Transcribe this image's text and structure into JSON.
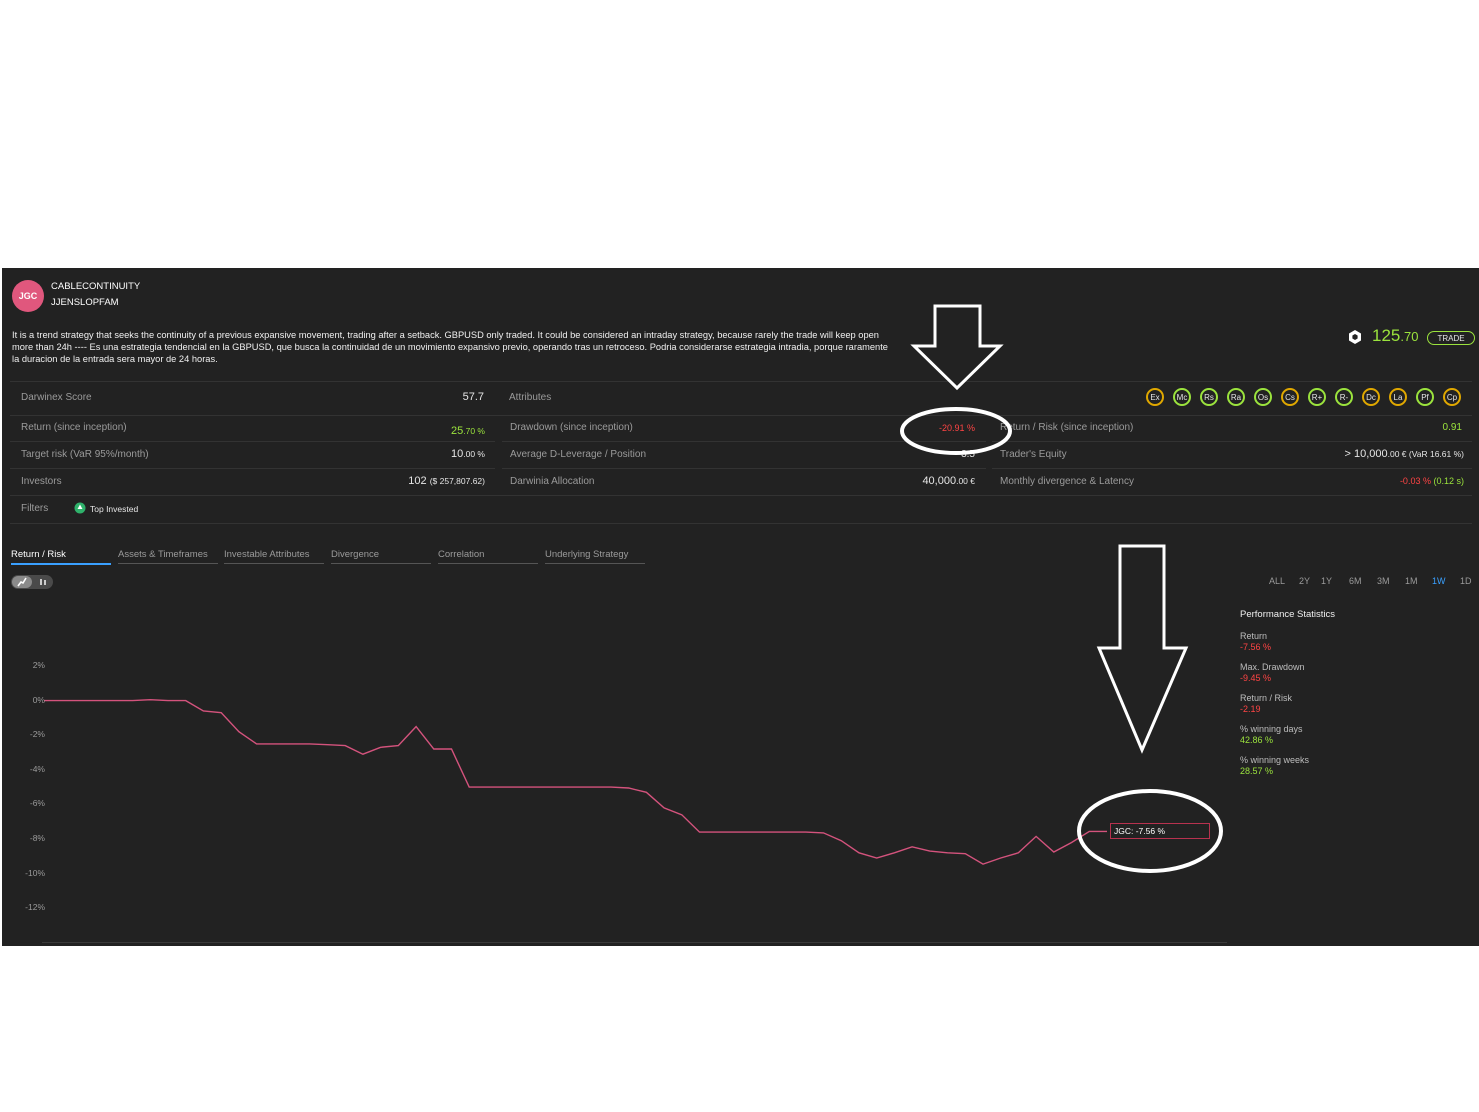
{
  "header": {
    "avatar_initials": "JGC",
    "strategy_name": "CABLECONTINUITY",
    "trader": "JJENSLOPFAM"
  },
  "description": "It is a trend strategy that seeks the continuity of a previous expansive movement, trading after a setback. GBPUSD only traded. It could be considered an intraday strategy, because rarely the trade will keep open more than 24h ---- Es una estrategia tendencial en la GBPUSD, que busca la continuidad de un movimiento expansivo previo, operando tras un retroceso. Podria considerarse estrategia intradia, porque raramente la duracion de la entrada sera mayor de 24 horas.",
  "quote": {
    "integer": "125",
    "decimal": ".70",
    "trade_label": "TRADE",
    "icon": "hexagon-icon"
  },
  "stats": {
    "darwinex_score_label": "Darwinex Score",
    "darwinex_score_value": "57.7",
    "attributes_label": "Attributes",
    "return_label": "Return (since inception)",
    "return_int": "25",
    "return_dec": ".70 %",
    "drawdown_label": "Drawdown (since inception)",
    "drawdown_value": "-20.91 %",
    "return_risk_label": "Return / Risk (since inception)",
    "return_risk_value": "0.91",
    "target_risk_label": "Target risk (VaR 95%/month)",
    "target_risk_int": "10",
    "target_risk_dec": ".00 %",
    "leverage_label": "Average D-Leverage / Position",
    "leverage_value": "3.5",
    "equity_label": "Trader's Equity",
    "equity_main": "> 10,000",
    "equity_rest": ".00 € (VaR 16.61 %)",
    "investors_label": "Investors",
    "investors_value": "102",
    "investors_amount": "($ 257,807.62)",
    "allocation_label": "Darwinia Allocation",
    "allocation_int": "40,000",
    "allocation_dec": ".00 €",
    "divergence_label": "Monthly divergence & Latency",
    "divergence_value": "-0.03 %",
    "latency_value": "(0.12 s)",
    "filters_label": "Filters",
    "filter_tag": "Top Invested"
  },
  "attribute_badges": [
    {
      "label": "Ex",
      "color": "#e0a800"
    },
    {
      "label": "Mc",
      "color": "#9be33d"
    },
    {
      "label": "Rs",
      "color": "#9be33d"
    },
    {
      "label": "Ra",
      "color": "#9be33d"
    },
    {
      "label": "Os",
      "color": "#9be33d"
    },
    {
      "label": "Cs",
      "color": "#e0a800"
    },
    {
      "label": "R+",
      "color": "#9be33d"
    },
    {
      "label": "R-",
      "color": "#9be33d"
    },
    {
      "label": "Dc",
      "color": "#e0a800"
    },
    {
      "label": "La",
      "color": "#e0a800"
    },
    {
      "label": "Pf",
      "color": "#9be33d"
    },
    {
      "label": "Cp",
      "color": "#e0a800"
    }
  ],
  "tabs": [
    "Return / Risk",
    "Assets & Timeframes",
    "Investable Attributes",
    "Divergence",
    "Correlation",
    "Underlying Strategy"
  ],
  "ranges": [
    "ALL",
    "2Y",
    "1Y",
    "6M",
    "3M",
    "1M",
    "1W",
    "1D"
  ],
  "active_range": "1W",
  "performance": {
    "title": "Performance Statistics",
    "items": [
      {
        "label": "Return",
        "value": "-7.56 %",
        "color": "#ff4444"
      },
      {
        "label": "Max. Drawdown",
        "value": "-9.45 %",
        "color": "#ff4444"
      },
      {
        "label": "Return / Risk",
        "value": "-2.19",
        "color": "#ff4444"
      },
      {
        "label": "% winning days",
        "value": "42.86 %",
        "color": "#9be33d"
      },
      {
        "label": "% winning weeks",
        "value": "28.57 %",
        "color": "#9be33d"
      }
    ]
  },
  "tooltip": "JGC: -7.56 %",
  "chart_data": {
    "type": "line",
    "yticks": [
      "2%",
      "0%",
      "-2%",
      "-4%",
      "-6%",
      "-8%",
      "-10%",
      "-12%"
    ],
    "ylim": [
      -12,
      2
    ],
    "series": [
      {
        "name": "JGC",
        "color": "#d4537d",
        "values": [
          0,
          0,
          0,
          0,
          0,
          0,
          0.05,
          0,
          0,
          -0.6,
          -0.7,
          -1.8,
          -2.5,
          -2.5,
          -2.5,
          -2.5,
          -2.55,
          -2.6,
          -3.1,
          -2.7,
          -2.6,
          -1.5,
          -2.8,
          -2.8,
          -5.0,
          -5.0,
          -5.0,
          -5.0,
          -5.0,
          -5.0,
          -5.0,
          -5.0,
          -5.0,
          -5.05,
          -5.3,
          -6.2,
          -6.6,
          -7.6,
          -7.6,
          -7.6,
          -7.6,
          -7.6,
          -7.6,
          -7.6,
          -7.65,
          -8.1,
          -8.8,
          -9.1,
          -8.8,
          -8.45,
          -8.7,
          -8.8,
          -8.85,
          -9.45,
          -9.1,
          -8.8,
          -7.85,
          -8.75,
          -8.2,
          -7.56,
          -7.56
        ]
      }
    ]
  },
  "colors": {
    "accent": "#9be33d",
    "negative": "#ff4444",
    "active_tab": "#3aa0ff"
  }
}
